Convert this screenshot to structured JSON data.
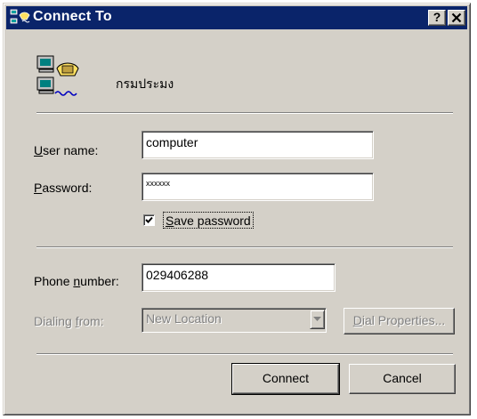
{
  "window": {
    "title": "Connect To",
    "help_button": "?",
    "close_button": "✕"
  },
  "connection": {
    "name": "กรมประมง"
  },
  "form": {
    "username_label_hotkey": "U",
    "username_label_rest": "ser name:",
    "username_value": "computer",
    "password_label_hotkey": "P",
    "password_label_rest": "assword:",
    "password_value": "xxxxxx",
    "save_password_hotkey": "S",
    "save_password_rest": "ave password",
    "save_password_checked": true,
    "phone_label_pre": "Phone ",
    "phone_label_hotkey": "n",
    "phone_label_rest": "umber:",
    "phone_value": "029406288",
    "dialing_label_pre": "Dialing ",
    "dialing_label_hotkey": "f",
    "dialing_label_rest": "rom:",
    "dialing_value": "New Location",
    "dial_properties_hotkey": "D",
    "dial_properties_rest": "ial Properties..."
  },
  "buttons": {
    "connect": "Connect",
    "cancel": "Cancel"
  },
  "colors": {
    "titlebar": "#0a246a",
    "dialog_face": "#d4d0c8"
  },
  "icons": {
    "title": "network-connection-icon",
    "connection": "dialup-computers-phone-icon"
  }
}
